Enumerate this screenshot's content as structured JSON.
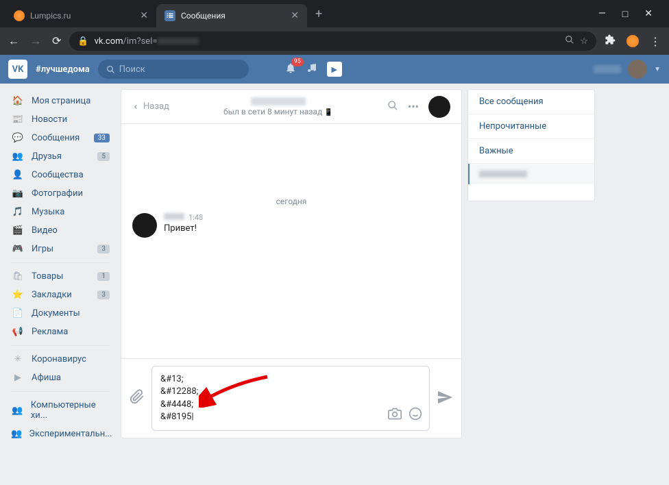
{
  "window": {
    "minimize": "—",
    "maximize": "□",
    "close": "✕"
  },
  "tabs": [
    {
      "title": "Lumpics.ru",
      "active": false
    },
    {
      "title": "Сообщения",
      "active": true
    }
  ],
  "address": {
    "host": "vk.com",
    "path": "/im?sel="
  },
  "vk": {
    "logo": "VK",
    "hashtag": "#лучшедома",
    "search_placeholder": "Поиск",
    "notif_count": "95"
  },
  "sidebar": {
    "items": [
      {
        "icon": "home",
        "label": "Моя страница"
      },
      {
        "icon": "news",
        "label": "Новости"
      },
      {
        "icon": "msg",
        "label": "Сообщения",
        "badge": "33",
        "active": true
      },
      {
        "icon": "friends",
        "label": "Друзья",
        "badge": "5"
      },
      {
        "icon": "groups",
        "label": "Сообщества"
      },
      {
        "icon": "photo",
        "label": "Фотографии"
      },
      {
        "icon": "music",
        "label": "Музыка"
      },
      {
        "icon": "video",
        "label": "Видео"
      },
      {
        "icon": "games",
        "label": "Игры",
        "badge": "3"
      }
    ],
    "items2": [
      {
        "icon": "shop",
        "label": "Товары",
        "badge": "1"
      },
      {
        "icon": "bookmark",
        "label": "Закладки",
        "badge": "3"
      },
      {
        "icon": "docs",
        "label": "Документы"
      },
      {
        "icon": "ads",
        "label": "Реклама"
      }
    ],
    "items3": [
      {
        "icon": "virus",
        "label": "Коронавирус"
      },
      {
        "icon": "afisha",
        "label": "Афиша"
      }
    ],
    "items4": [
      {
        "icon": "gear",
        "label": "Компьютерные хи..."
      },
      {
        "icon": "gear",
        "label": "Экспериментальн..."
      }
    ]
  },
  "chat": {
    "back": "Назад",
    "status": "был в сети 8 минут назад",
    "date": "сегодня",
    "msg_time": "1:48",
    "msg_text": "Привет!",
    "input_lines": [
      "&#13;",
      "&#12288;",
      "&#4448;",
      "&#8195"
    ]
  },
  "filters": {
    "all": "Все сообщения",
    "unread": "Непрочитанные",
    "important": "Важные"
  }
}
